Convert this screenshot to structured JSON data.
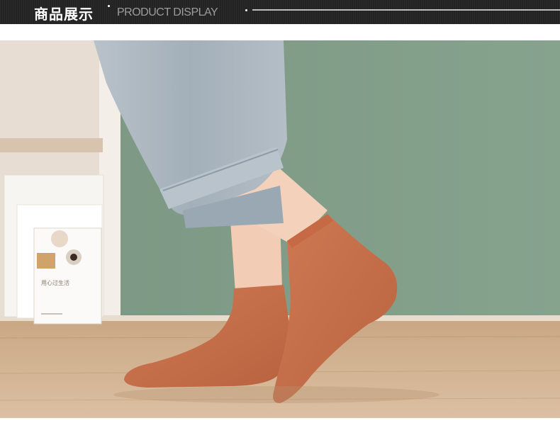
{
  "header": {
    "title_cn": "商品展示",
    "title_en": "PRODUCT DISPLAY"
  },
  "photo": {
    "subject": "ankle socks product photo",
    "sock_color": "#c8714c",
    "wall_color": "#7e9b85",
    "floor_color": "#d2b392",
    "jeans_color": "#aab4bc",
    "book_text": "用心过生活"
  },
  "colors": {
    "header_bg": "#232323",
    "title_cn": "#ffffff",
    "title_en": "#9c9c9c"
  }
}
